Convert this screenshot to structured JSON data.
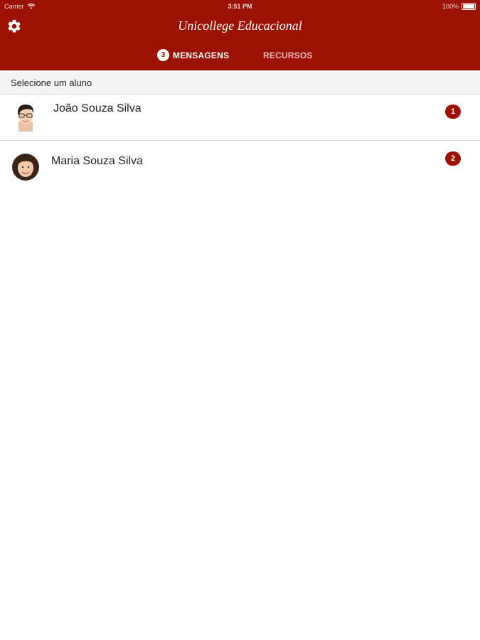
{
  "status_bar": {
    "carrier": "Carrier",
    "time": "3:51 PM",
    "battery": "100%"
  },
  "header": {
    "title": "Unicollege Educacional"
  },
  "tabs": {
    "messages": {
      "label": "MENSAGENS",
      "count": "3"
    },
    "resources": {
      "label": "RECURSOS"
    }
  },
  "section": {
    "label": "Selecione um aluno"
  },
  "students": [
    {
      "name": "João Souza Silva",
      "unread": "1"
    },
    {
      "name": "Maria Souza Silva",
      "unread": "2"
    }
  ],
  "colors": {
    "brand": "#9b1202",
    "section_bg": "#f4f4f4"
  }
}
